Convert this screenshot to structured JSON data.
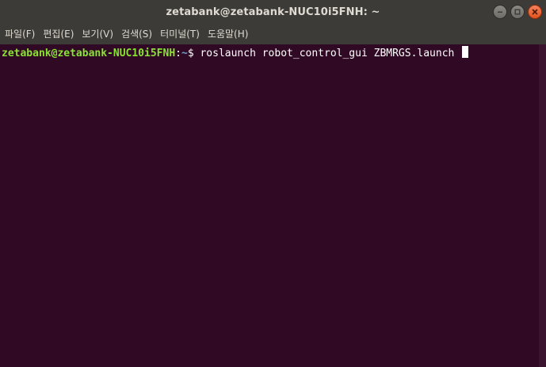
{
  "window": {
    "title": "zetabank@zetabank-NUC10i5FNH: ~"
  },
  "menu": {
    "items": [
      {
        "label": "파일(F)"
      },
      {
        "label": "편집(E)"
      },
      {
        "label": "보기(V)"
      },
      {
        "label": "검색(S)"
      },
      {
        "label": "터미널(T)"
      },
      {
        "label": "도움말(H)"
      }
    ]
  },
  "terminal": {
    "prompt_user_host": "zetabank@zetabank-NUC10i5FNH",
    "prompt_colon": ":",
    "prompt_path": "~",
    "prompt_symbol": "$ ",
    "command": "roslaunch robot_control_gui ZBMRGS.launch "
  },
  "colors": {
    "terminal_bg": "#300a24",
    "titlebar_bg": "#3c3b37",
    "prompt_user": "#8ae234",
    "prompt_path": "#729fcf",
    "close_button": "#e95420"
  },
  "icons": {
    "minimize": "minimize-icon",
    "maximize": "maximize-icon",
    "close": "close-icon"
  }
}
